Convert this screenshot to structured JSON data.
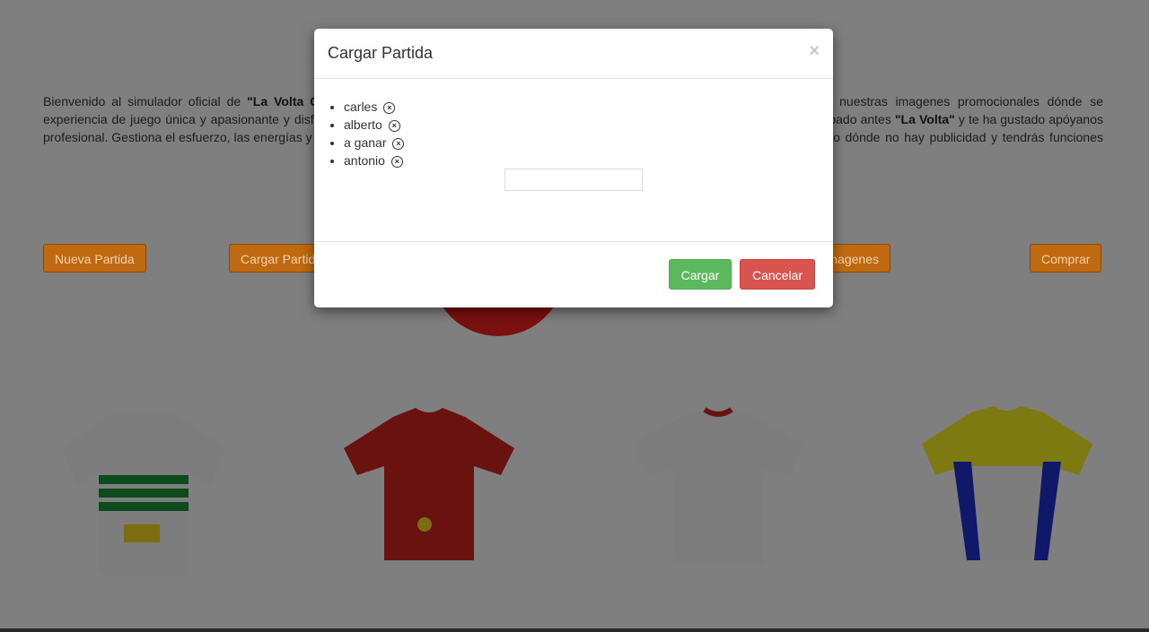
{
  "intro_left": {
    "p1": "Bienvenido al simulador oficial de ",
    "b1": "\"La Volta Ciclista a Catalunya\" ®",
    "p2": " . Únete a una experiencia de juego única y apasionante y disfruta de la emoción de dirigir a un equipo profesional. Gestiona el esfuerzo, las energías y la distancia máxima de tus corredores."
  },
  "intro_right": {
    "p1": "Antes de probar el juego puedes ver nuestras imagenes promocionales dónde se muestra como es el juego. Si ya has probado antes ",
    "b1": "\"La Volta\"",
    "p2": " y te ha gustado apóyanos comprando la versión completa del juego dónde no hay publicidad y tendrás funciones exclusivas del juego."
  },
  "buttons": {
    "new_game": "Nueva Partida",
    "load_game": "Cargar Partida",
    "images": "Imagenes",
    "buy": "Comprar"
  },
  "modal": {
    "title": "Cargar Partida",
    "close": "×",
    "saves": [
      "carles",
      "alberto",
      "a ganar",
      "antonio"
    ],
    "delete_icon": "⊗",
    "input_value": "",
    "load_label": "Cargar",
    "cancel_label": "Cancelar"
  },
  "colors": {
    "load": "#5cb85c",
    "cancel": "#d9534f",
    "accent": "#f0ad4e"
  }
}
